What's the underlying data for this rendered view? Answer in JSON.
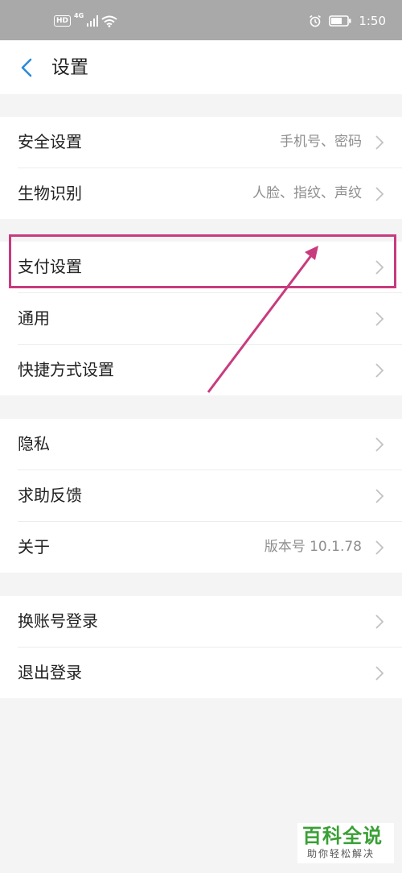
{
  "status_bar": {
    "hd": "HD",
    "network": "4G",
    "time": "1:50"
  },
  "header": {
    "title": "设置"
  },
  "groups": [
    {
      "items": [
        {
          "label": "安全设置",
          "value": "手机号、密码"
        },
        {
          "label": "生物识别",
          "value": "人脸、指纹、声纹"
        }
      ]
    },
    {
      "items": [
        {
          "label": "支付设置",
          "value": ""
        },
        {
          "label": "通用",
          "value": ""
        },
        {
          "label": "快捷方式设置",
          "value": ""
        }
      ]
    },
    {
      "items": [
        {
          "label": "隐私",
          "value": ""
        },
        {
          "label": "求助反馈",
          "value": ""
        },
        {
          "label": "关于",
          "value": "版本号 10.1.78"
        }
      ]
    },
    {
      "items": [
        {
          "label": "换账号登录",
          "value": ""
        },
        {
          "label": "退出登录",
          "value": ""
        }
      ]
    }
  ],
  "watermark": {
    "title": "百科全说",
    "subtitle": "助你轻松解决"
  },
  "colors": {
    "accent": "#2a8bd9",
    "annotation": "#c83b7e",
    "watermark_green": "#39a035"
  }
}
